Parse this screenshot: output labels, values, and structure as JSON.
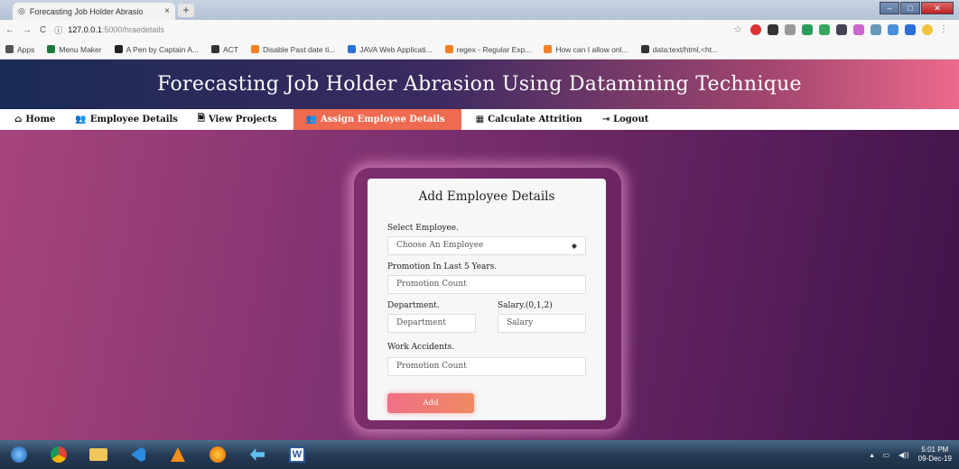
{
  "browser": {
    "tab_title": "Forecasting Job Holder Abrasio",
    "tab_close": "×",
    "new_tab": "+",
    "url_host": "127.0.0.1",
    "url_rest": ":5000/hraedetails",
    "bookmarks": [
      {
        "label": "Apps",
        "icon": "apps-grid-icon",
        "color": "#555"
      },
      {
        "label": "Menu Maker",
        "icon": "bookmark-icon",
        "color": "#1f7a3a"
      },
      {
        "label": "A Pen by Captain A...",
        "icon": "codepen-icon",
        "color": "#222"
      },
      {
        "label": "ACT",
        "icon": "globe-icon",
        "color": "#333"
      },
      {
        "label": "Disable Past date ti...",
        "icon": "stackoverflow-icon",
        "color": "#f48024"
      },
      {
        "label": "JAVA Web Applicati...",
        "icon": "document-icon",
        "color": "#2b6fd6"
      },
      {
        "label": "regex - Regular Exp...",
        "icon": "stackoverflow-icon",
        "color": "#f48024"
      },
      {
        "label": "How can I allow onl...",
        "icon": "stackoverflow-icon",
        "color": "#f48024"
      },
      {
        "label": "data:text/html,<ht...",
        "icon": "globe-icon",
        "color": "#333"
      }
    ]
  },
  "header": {
    "title": "Forecasting Job Holder Abrasion Using Datamining Technique"
  },
  "nav": {
    "items": [
      {
        "label": "Home",
        "icon": "home-icon",
        "glyph": "⌂"
      },
      {
        "label": "Employee Details",
        "icon": "users-icon",
        "glyph": "👥"
      },
      {
        "label": "View Projects",
        "icon": "file-icon",
        "glyph": "🗎"
      },
      {
        "label": "Assign Employee Details",
        "icon": "users-icon",
        "glyph": "👥"
      },
      {
        "label": "Calculate Attrition",
        "icon": "calculator-icon",
        "glyph": "▦"
      },
      {
        "label": "Logout",
        "icon": "logout-icon",
        "glyph": "⇥"
      }
    ]
  },
  "form": {
    "title": "Add Employee Details",
    "employee_label": "Select Employee.",
    "employee_value": "Choose An Employee",
    "promotion_label": "Promotion In Last 5 Years.",
    "promotion_placeholder": "Promotion Count",
    "department_label": "Department.",
    "department_placeholder": "Department",
    "salary_label": "Salary.(0,1,2)",
    "salary_placeholder": "Salary",
    "accidents_label": "Work Accidents.",
    "accidents_placeholder": "Promotion Count",
    "submit_label": "Add"
  },
  "taskbar": {
    "time": "5:01 PM",
    "date": "09-Dec-19"
  },
  "colors": {
    "accent": "#ee6a50",
    "button_start": "#f07088",
    "button_end": "#ef8a60"
  }
}
